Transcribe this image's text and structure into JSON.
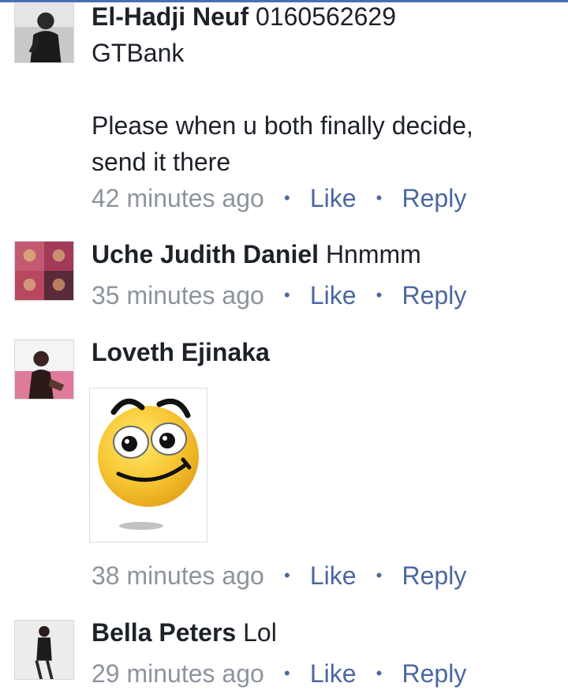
{
  "comments": [
    {
      "author": "El-Hadji Neuf",
      "text": "0160562629",
      "text_lines": [
        "GTBank",
        "",
        "Please when u both finally decide,",
        "send it there"
      ],
      "time": "42 minutes ago",
      "like_label": "Like",
      "reply_label": "Reply",
      "separator": "•"
    },
    {
      "author": "Uche Judith Daniel",
      "text": "Hnmmm",
      "time": "35 minutes ago",
      "like_label": "Like",
      "reply_label": "Reply",
      "separator": "•"
    },
    {
      "author": "Loveth Ejinaka",
      "text": "",
      "attachment": "smiley-sticker",
      "time": "38 minutes ago",
      "like_label": "Like",
      "reply_label": "Reply",
      "separator": "•"
    },
    {
      "author": "Bella Peters",
      "text": "Lol",
      "time": "29 minutes ago",
      "like_label": "Like",
      "reply_label": "Reply",
      "separator": "•"
    }
  ],
  "colors": {
    "link": "#4b67a1",
    "meta": "#8d949e",
    "text": "#1d2129",
    "top_bar": "#4a6eb5"
  }
}
